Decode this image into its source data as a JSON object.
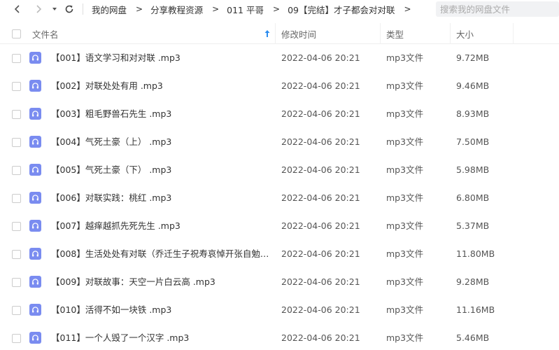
{
  "breadcrumb": [
    "我的网盘",
    "分享教程资源",
    "011 平哥",
    "09【完结】才子都会对对联"
  ],
  "search": {
    "placeholder": "搜索我的网盘文件"
  },
  "columns": {
    "name": "文件名",
    "time": "修改时间",
    "type": "类型",
    "size": "大小"
  },
  "icons": {
    "back": "chevron-left-icon",
    "forward": "chevron-right-icon",
    "dropdown": "caret-down-icon",
    "refresh": "refresh-icon",
    "sort": "sort-ascending-icon",
    "file": "headphones-icon"
  },
  "colors": {
    "file_icon": "#7a8cf0",
    "sort_accent": "#2b8cef"
  },
  "files": [
    {
      "name": "【001】语文学习和对对联 .mp3",
      "time": "2022-04-06 20:21",
      "type": "mp3文件",
      "size": "9.72MB"
    },
    {
      "name": "【002】对联处处有用 .mp3",
      "time": "2022-04-06 20:21",
      "type": "mp3文件",
      "size": "9.46MB"
    },
    {
      "name": "【003】粗毛野兽石先生 .mp3",
      "time": "2022-04-06 20:21",
      "type": "mp3文件",
      "size": "8.93MB"
    },
    {
      "name": "【004】气死土豪（上） .mp3",
      "time": "2022-04-06 20:21",
      "type": "mp3文件",
      "size": "7.50MB"
    },
    {
      "name": "【005】气死土豪（下） .mp3",
      "time": "2022-04-06 20:21",
      "type": "mp3文件",
      "size": "5.98MB"
    },
    {
      "name": "【006】对联实践：桃红 .mp3",
      "time": "2022-04-06 20:21",
      "type": "mp3文件",
      "size": "6.80MB"
    },
    {
      "name": "【007】越痒越抓先死先生 .mp3",
      "time": "2022-04-06 20:21",
      "type": "mp3文件",
      "size": "5.37MB"
    },
    {
      "name": "【008】生活处处有对联（乔迁生子祝寿哀悼开张自勉）....",
      "time": "2022-04-06 20:21",
      "type": "mp3文件",
      "size": "11.80MB"
    },
    {
      "name": "【009】对联故事：天空一片白云高 .mp3",
      "time": "2022-04-06 20:21",
      "type": "mp3文件",
      "size": "9.28MB"
    },
    {
      "name": "【010】活得不如一块铁 .mp3",
      "time": "2022-04-06 20:21",
      "type": "mp3文件",
      "size": "11.16MB"
    },
    {
      "name": "【011】一个人毁了一个汉字 .mp3",
      "time": "2022-04-06 20:21",
      "type": "mp3文件",
      "size": "5.46MB"
    }
  ]
}
